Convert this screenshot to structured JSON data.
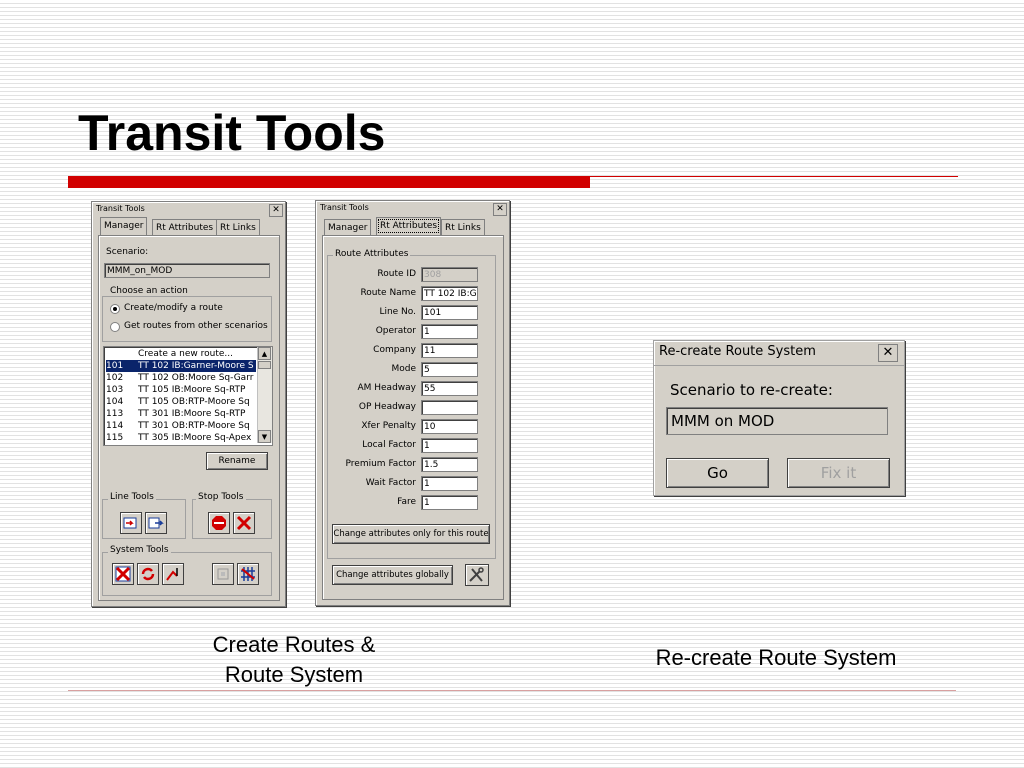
{
  "slide": {
    "title": "Transit Tools",
    "caption_left_line1": "Create Routes &",
    "caption_left_line2": "Route System",
    "caption_right": "Re-create Route System",
    "accent_red": "#d10000"
  },
  "win1": {
    "title": "Transit Tools",
    "close": "✕",
    "tabs": [
      "Manager",
      "Rt Attributes",
      "Rt Links"
    ],
    "scenario_label": "Scenario:",
    "scenario_value": "MMM_on_MOD",
    "action_group": "Choose an action",
    "radio1": "Create/modify a route",
    "radio2": "Get routes from other scenarios",
    "list_header": "Create a new route...",
    "routes": [
      {
        "id": "101",
        "name": "TT 102 IB:Garner-Moore S"
      },
      {
        "id": "102",
        "name": "TT 102 OB:Moore Sq-Garr"
      },
      {
        "id": "103",
        "name": "TT 105 IB:Moore Sq-RTP"
      },
      {
        "id": "104",
        "name": "TT 105 OB:RTP-Moore Sq"
      },
      {
        "id": "113",
        "name": "TT 301 IB:Moore Sq-RTP"
      },
      {
        "id": "114",
        "name": "TT 301 OB:RTP-Moore Sq"
      },
      {
        "id": "115",
        "name": "TT 305 IB:Moore Sq-Apex"
      }
    ],
    "rename": "Rename",
    "line_tools": "Line Tools",
    "stop_tools": "Stop Tools",
    "system_tools": "System Tools"
  },
  "win2": {
    "title": "Transit Tools",
    "close": "✕",
    "tabs": [
      "Manager",
      "Rt Attributes",
      "Rt Links"
    ],
    "group": "Route Attributes",
    "fields": [
      {
        "label": "Route ID",
        "value": "308"
      },
      {
        "label": "Route Name",
        "value": "TT 102 IB:G"
      },
      {
        "label": "Line No.",
        "value": "101"
      },
      {
        "label": "Operator",
        "value": "1"
      },
      {
        "label": "Company",
        "value": "11"
      },
      {
        "label": "Mode",
        "value": "5"
      },
      {
        "label": "AM Headway",
        "value": "55"
      },
      {
        "label": "OP Headway",
        "value": ""
      },
      {
        "label": "Xfer Penalty",
        "value": "10"
      },
      {
        "label": "Local Factor",
        "value": "1"
      },
      {
        "label": "Premium Factor",
        "value": "1.5"
      },
      {
        "label": "Wait Factor",
        "value": "1"
      },
      {
        "label": "Fare",
        "value": "1"
      }
    ],
    "change_route": "Change attributes only for this route",
    "change_global": "Change attributes globally"
  },
  "win3": {
    "title": "Re-create Route System",
    "close": "✕",
    "prompt": "Scenario to re-create:",
    "value": "MMM on MOD",
    "go": "Go",
    "fixit": "Fix it"
  }
}
